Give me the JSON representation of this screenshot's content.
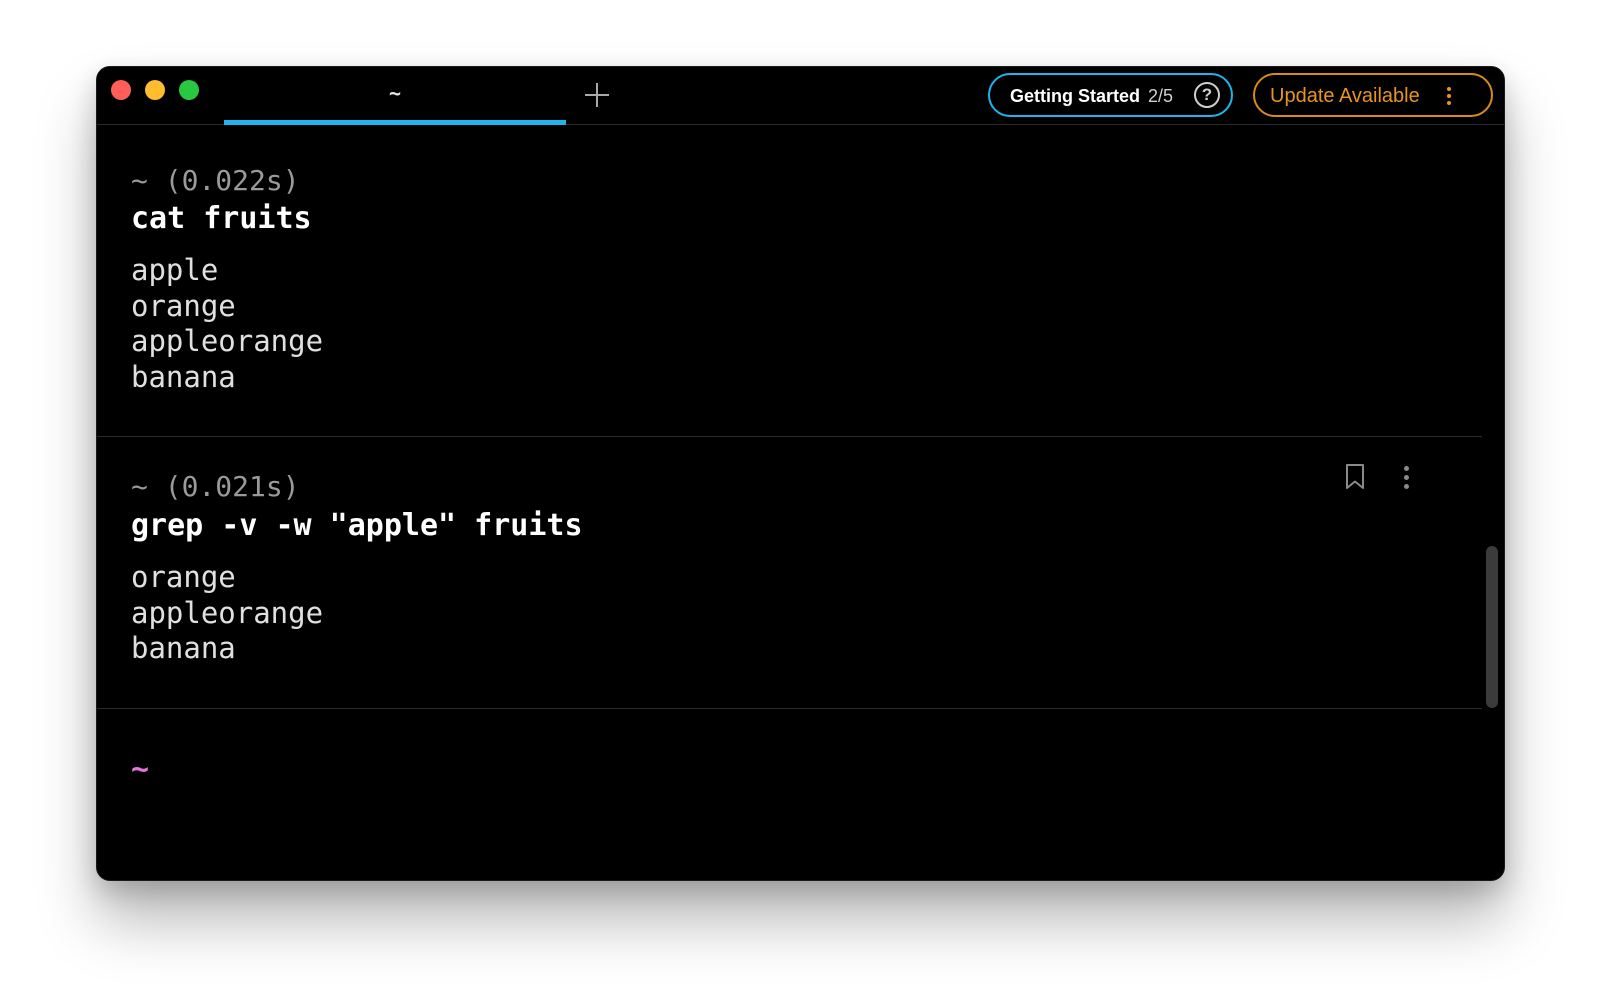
{
  "tabs": [
    {
      "label": "~",
      "active": true
    }
  ],
  "header": {
    "getting_started": {
      "label": "Getting Started",
      "progress": "2/5",
      "help_icon": "question-circle-icon"
    },
    "update": {
      "label": "Update Available",
      "menu_icon": "vertical-ellipsis-icon"
    },
    "new_tab_icon": "plus-icon"
  },
  "blocks": [
    {
      "meta": "~ (0.022s)",
      "command": "cat fruits",
      "output": [
        "apple",
        "orange",
        "appleorange",
        "banana"
      ]
    },
    {
      "meta": "~ (0.021s)",
      "command": "grep -v -w \"apple\" fruits",
      "output": [
        "orange",
        "appleorange",
        "banana"
      ],
      "actions": [
        "bookmark-icon",
        "vertical-ellipsis-icon"
      ]
    }
  ],
  "input": {
    "prompt": "~"
  },
  "colors": {
    "accent": "#1fb4ee",
    "update": "#e89422",
    "prompt": "#e573e0",
    "background": "#000000"
  }
}
